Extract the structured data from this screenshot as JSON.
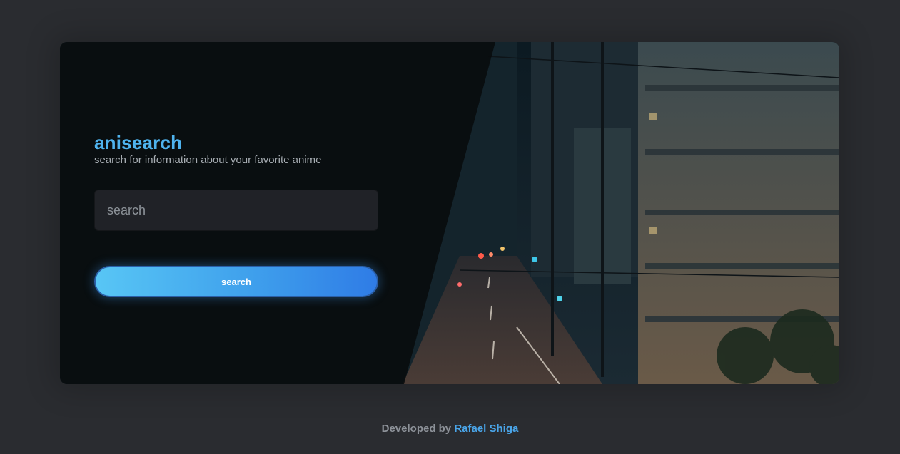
{
  "app": {
    "title": "anisearch",
    "subtitle": "search for information about your favorite anime"
  },
  "search": {
    "placeholder": "search",
    "value": "",
    "button_label": "search"
  },
  "footer": {
    "prefix": "Developed by",
    "author": "Rafael Shiga"
  },
  "colors": {
    "accent": "#4fb3ee",
    "background": "#2a2c30",
    "button_gradient_start": "#58c6f5",
    "button_gradient_end": "#2f7ce6"
  }
}
